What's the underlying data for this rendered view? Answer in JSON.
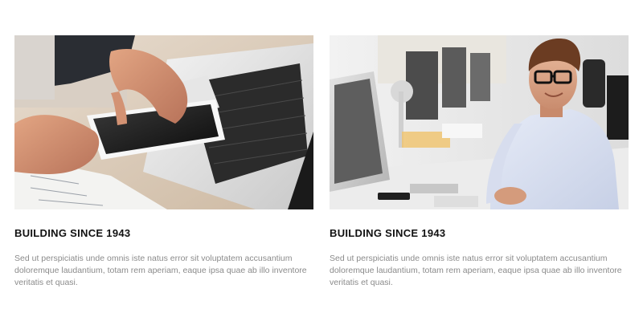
{
  "cards": [
    {
      "image_alt": "Hands holding a tablet above a laptop keyboard",
      "title": "BUILDING SINCE 1943",
      "description": "Sed ut perspiciatis unde omnis iste natus error sit voluptatem accusantium doloremque laudantium, totam rem aperiam, eaque ipsa quae ab illo inventore veritatis et quasi."
    },
    {
      "image_alt": "Smiling man with glasses sitting at an office desk with computers",
      "title": "BUILDING SINCE 1943",
      "description": "Sed ut perspiciatis unde omnis iste natus error sit voluptatem accusantium doloremque laudantium, totam rem aperiam, eaque ipsa quae ab illo inventore veritatis et quasi."
    }
  ],
  "colors": {
    "title": "#111111",
    "description": "#8b8b8b",
    "background": "#ffffff"
  }
}
